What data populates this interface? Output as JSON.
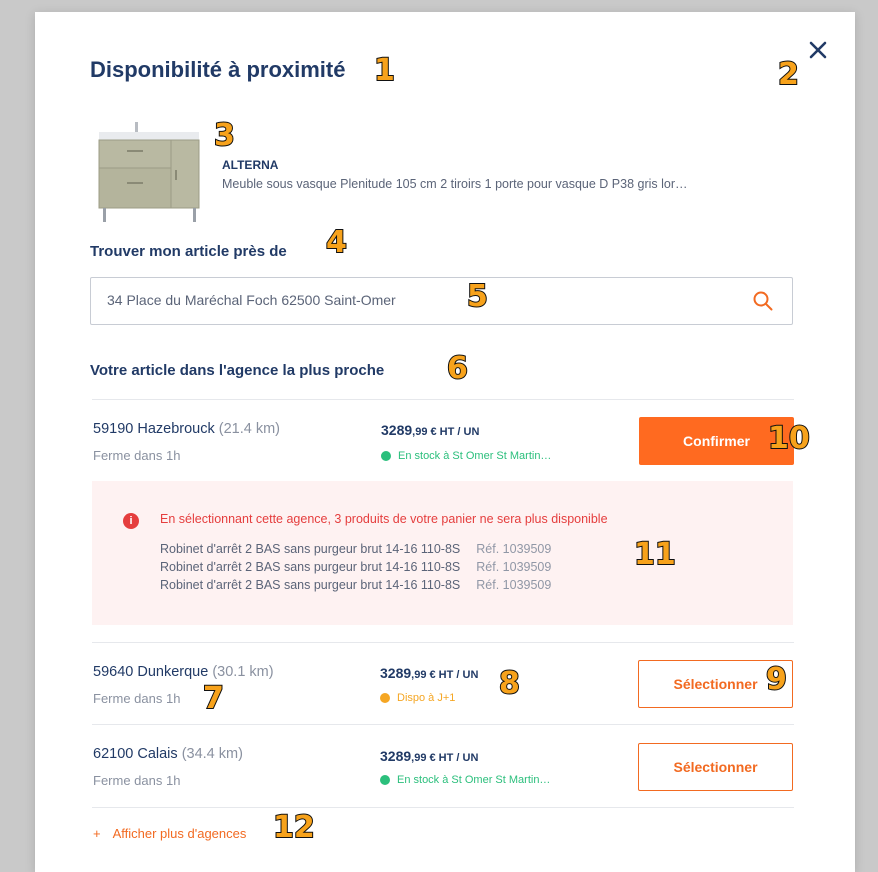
{
  "modal": {
    "title": "Disponibilité à proximité",
    "product": {
      "brand": "ALTERNA",
      "description": "Meuble sous vasque Plenitude 105 cm 2 tiroirs 1 porte pour vasque D P38 gris lor…"
    },
    "find_label": "Trouver mon article près de",
    "search": {
      "value": "34 Place du Maréchal Foch 62500 Saint-Omer"
    },
    "nearest_label": "Votre article dans l'agence la plus proche",
    "agencies": [
      {
        "name": "59190 Hazebrouck",
        "distance": "(21.4 km)",
        "closing": "Ferme dans 1h",
        "price_main": "3289",
        "price_cents": ",99",
        "price_unit": " € HT / UN",
        "stock": "En stock à St Omer St Martin…",
        "stock_color": "#2bbf7c",
        "button": "Confirmer"
      },
      {
        "name": "59640 Dunkerque",
        "distance": "(30.1 km)",
        "closing": "Ferme dans 1h",
        "price_main": "3289",
        "price_cents": ",99",
        "price_unit": " € HT / UN",
        "stock": "Dispo à J+1",
        "stock_color": "#f5a623",
        "button": "Sélectionner"
      },
      {
        "name": "62100 Calais",
        "distance": "(34.4 km)",
        "closing": "Ferme dans 1h",
        "price_main": "3289",
        "price_cents": ",99",
        "price_unit": " € HT / UN",
        "stock": "En stock à St Omer St Martin…",
        "stock_color": "#2bbf7c",
        "button": "Sélectionner"
      }
    ],
    "warning": {
      "message": "En sélectionnant cette agence, 3 produits de votre panier ne sera plus disponible",
      "items": [
        {
          "name": "Robinet d'arrêt 2 BAS sans purgeur brut 14-16 110-8S",
          "ref": "Réf. 1039509"
        },
        {
          "name": "Robinet d'arrêt 2 BAS sans purgeur brut 14-16 110-8S",
          "ref": "Réf. 1039509"
        },
        {
          "name": "Robinet d'arrêt 2 BAS sans purgeur brut 14-16 110-8S",
          "ref": "Réf. 1039509"
        }
      ]
    },
    "more_agencies": "Afficher plus d'agences",
    "icons": {
      "close": "close-icon",
      "search": "search-icon",
      "warning": "warning-icon",
      "plus": "plus-icon"
    }
  },
  "annotations": [
    "1",
    "2",
    "3",
    "4",
    "5",
    "6",
    "7",
    "8",
    "9",
    "10",
    "11",
    "12"
  ],
  "colors": {
    "accent": "#ff6a20",
    "navy": "#213a66",
    "error": "#e53e3e",
    "in_stock": "#2bbf7c",
    "delayed": "#f5a623"
  }
}
